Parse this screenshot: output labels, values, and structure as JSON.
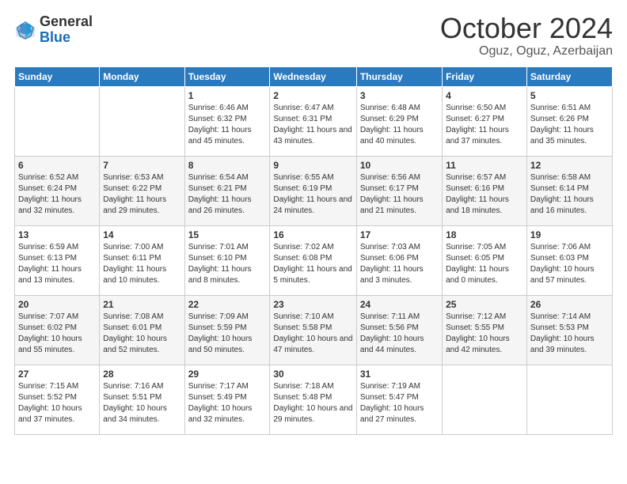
{
  "logo": {
    "general": "General",
    "blue": "Blue"
  },
  "title": "October 2024",
  "location": "Oguz, Oguz, Azerbaijan",
  "days_header": [
    "Sunday",
    "Monday",
    "Tuesday",
    "Wednesday",
    "Thursday",
    "Friday",
    "Saturday"
  ],
  "weeks": [
    [
      {
        "day": "",
        "info": ""
      },
      {
        "day": "",
        "info": ""
      },
      {
        "day": "1",
        "info": "Sunrise: 6:46 AM\nSunset: 6:32 PM\nDaylight: 11 hours and 45 minutes."
      },
      {
        "day": "2",
        "info": "Sunrise: 6:47 AM\nSunset: 6:31 PM\nDaylight: 11 hours and 43 minutes."
      },
      {
        "day": "3",
        "info": "Sunrise: 6:48 AM\nSunset: 6:29 PM\nDaylight: 11 hours and 40 minutes."
      },
      {
        "day": "4",
        "info": "Sunrise: 6:50 AM\nSunset: 6:27 PM\nDaylight: 11 hours and 37 minutes."
      },
      {
        "day": "5",
        "info": "Sunrise: 6:51 AM\nSunset: 6:26 PM\nDaylight: 11 hours and 35 minutes."
      }
    ],
    [
      {
        "day": "6",
        "info": "Sunrise: 6:52 AM\nSunset: 6:24 PM\nDaylight: 11 hours and 32 minutes."
      },
      {
        "day": "7",
        "info": "Sunrise: 6:53 AM\nSunset: 6:22 PM\nDaylight: 11 hours and 29 minutes."
      },
      {
        "day": "8",
        "info": "Sunrise: 6:54 AM\nSunset: 6:21 PM\nDaylight: 11 hours and 26 minutes."
      },
      {
        "day": "9",
        "info": "Sunrise: 6:55 AM\nSunset: 6:19 PM\nDaylight: 11 hours and 24 minutes."
      },
      {
        "day": "10",
        "info": "Sunrise: 6:56 AM\nSunset: 6:17 PM\nDaylight: 11 hours and 21 minutes."
      },
      {
        "day": "11",
        "info": "Sunrise: 6:57 AM\nSunset: 6:16 PM\nDaylight: 11 hours and 18 minutes."
      },
      {
        "day": "12",
        "info": "Sunrise: 6:58 AM\nSunset: 6:14 PM\nDaylight: 11 hours and 16 minutes."
      }
    ],
    [
      {
        "day": "13",
        "info": "Sunrise: 6:59 AM\nSunset: 6:13 PM\nDaylight: 11 hours and 13 minutes."
      },
      {
        "day": "14",
        "info": "Sunrise: 7:00 AM\nSunset: 6:11 PM\nDaylight: 11 hours and 10 minutes."
      },
      {
        "day": "15",
        "info": "Sunrise: 7:01 AM\nSunset: 6:10 PM\nDaylight: 11 hours and 8 minutes."
      },
      {
        "day": "16",
        "info": "Sunrise: 7:02 AM\nSunset: 6:08 PM\nDaylight: 11 hours and 5 minutes."
      },
      {
        "day": "17",
        "info": "Sunrise: 7:03 AM\nSunset: 6:06 PM\nDaylight: 11 hours and 3 minutes."
      },
      {
        "day": "18",
        "info": "Sunrise: 7:05 AM\nSunset: 6:05 PM\nDaylight: 11 hours and 0 minutes."
      },
      {
        "day": "19",
        "info": "Sunrise: 7:06 AM\nSunset: 6:03 PM\nDaylight: 10 hours and 57 minutes."
      }
    ],
    [
      {
        "day": "20",
        "info": "Sunrise: 7:07 AM\nSunset: 6:02 PM\nDaylight: 10 hours and 55 minutes."
      },
      {
        "day": "21",
        "info": "Sunrise: 7:08 AM\nSunset: 6:01 PM\nDaylight: 10 hours and 52 minutes."
      },
      {
        "day": "22",
        "info": "Sunrise: 7:09 AM\nSunset: 5:59 PM\nDaylight: 10 hours and 50 minutes."
      },
      {
        "day": "23",
        "info": "Sunrise: 7:10 AM\nSunset: 5:58 PM\nDaylight: 10 hours and 47 minutes."
      },
      {
        "day": "24",
        "info": "Sunrise: 7:11 AM\nSunset: 5:56 PM\nDaylight: 10 hours and 44 minutes."
      },
      {
        "day": "25",
        "info": "Sunrise: 7:12 AM\nSunset: 5:55 PM\nDaylight: 10 hours and 42 minutes."
      },
      {
        "day": "26",
        "info": "Sunrise: 7:14 AM\nSunset: 5:53 PM\nDaylight: 10 hours and 39 minutes."
      }
    ],
    [
      {
        "day": "27",
        "info": "Sunrise: 7:15 AM\nSunset: 5:52 PM\nDaylight: 10 hours and 37 minutes."
      },
      {
        "day": "28",
        "info": "Sunrise: 7:16 AM\nSunset: 5:51 PM\nDaylight: 10 hours and 34 minutes."
      },
      {
        "day": "29",
        "info": "Sunrise: 7:17 AM\nSunset: 5:49 PM\nDaylight: 10 hours and 32 minutes."
      },
      {
        "day": "30",
        "info": "Sunrise: 7:18 AM\nSunset: 5:48 PM\nDaylight: 10 hours and 29 minutes."
      },
      {
        "day": "31",
        "info": "Sunrise: 7:19 AM\nSunset: 5:47 PM\nDaylight: 10 hours and 27 minutes."
      },
      {
        "day": "",
        "info": ""
      },
      {
        "day": "",
        "info": ""
      }
    ]
  ]
}
